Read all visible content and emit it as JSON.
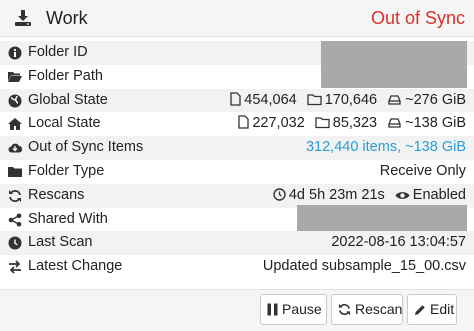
{
  "header": {
    "title": "Work",
    "status": "Out of Sync",
    "status_color": "#d9322b",
    "icon": "download-icon"
  },
  "rows": {
    "folder_id": {
      "label": "Folder ID",
      "value_redacted": true
    },
    "folder_path": {
      "label": "Folder Path",
      "value_redacted": true
    },
    "global_state": {
      "label": "Global State",
      "files": "454,064",
      "folders": "170,646",
      "size": "~276 GiB"
    },
    "local_state": {
      "label": "Local State",
      "files": "227,032",
      "folders": "85,323",
      "size": "~138 GiB"
    },
    "out_of_sync": {
      "label": "Out of Sync Items",
      "value": "312,440 items, ~138 GiB",
      "value_color": "#2a9fd6"
    },
    "folder_type": {
      "label": "Folder Type",
      "value": "Receive Only"
    },
    "rescans": {
      "label": "Rescans",
      "interval": "4d 5h 23m 21s",
      "watcher": "Enabled"
    },
    "shared_with": {
      "label": "Shared With",
      "value_redacted": true
    },
    "last_scan": {
      "label": "Last Scan",
      "value": "2022-08-16 13:04:57"
    },
    "latest_change": {
      "label": "Latest Change",
      "value": "Updated subsample_15_00.csv"
    }
  },
  "buttons": {
    "pause": "Pause",
    "rescan": "Rescan",
    "edit": "Edit"
  }
}
